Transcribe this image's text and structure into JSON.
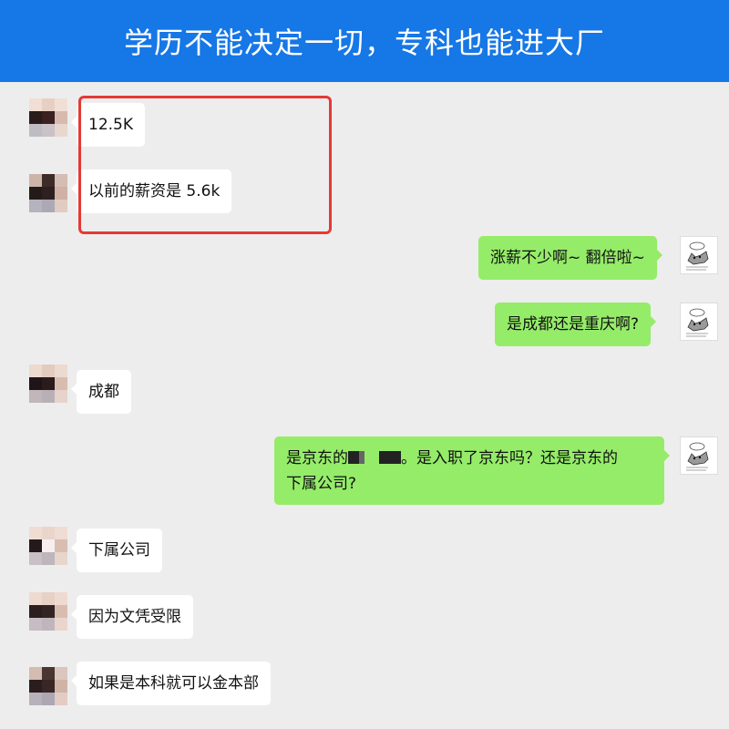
{
  "banner": {
    "title": "学历不能决定一切，专科也能进大厂"
  },
  "messages": [
    {
      "side": "left",
      "text": "12.5K"
    },
    {
      "side": "left",
      "text": "以前的薪资是 5.6k"
    },
    {
      "side": "right",
      "text": "涨薪不少啊~ 翻倍啦~"
    },
    {
      "side": "right",
      "text": "是成都还是重庆啊?"
    },
    {
      "side": "left",
      "text": "成都"
    },
    {
      "side": "right",
      "text_before": "是京东的",
      "text_after": "。是入职了京东吗？还是京东的",
      "text_line2": "下属公司?"
    },
    {
      "side": "left",
      "text": "下属公司"
    },
    {
      "side": "left",
      "text": "因为文凭受限"
    },
    {
      "side": "left",
      "text": "如果是本科就可以金本部"
    }
  ],
  "colors": {
    "banner": "#1677e6",
    "self_bubble": "#95ec69",
    "highlight_box": "#e53935",
    "background": "#ededed"
  },
  "icons": {
    "self_avatar": "cat-sticker-icon",
    "other_avatar": "pixelated-avatar"
  }
}
